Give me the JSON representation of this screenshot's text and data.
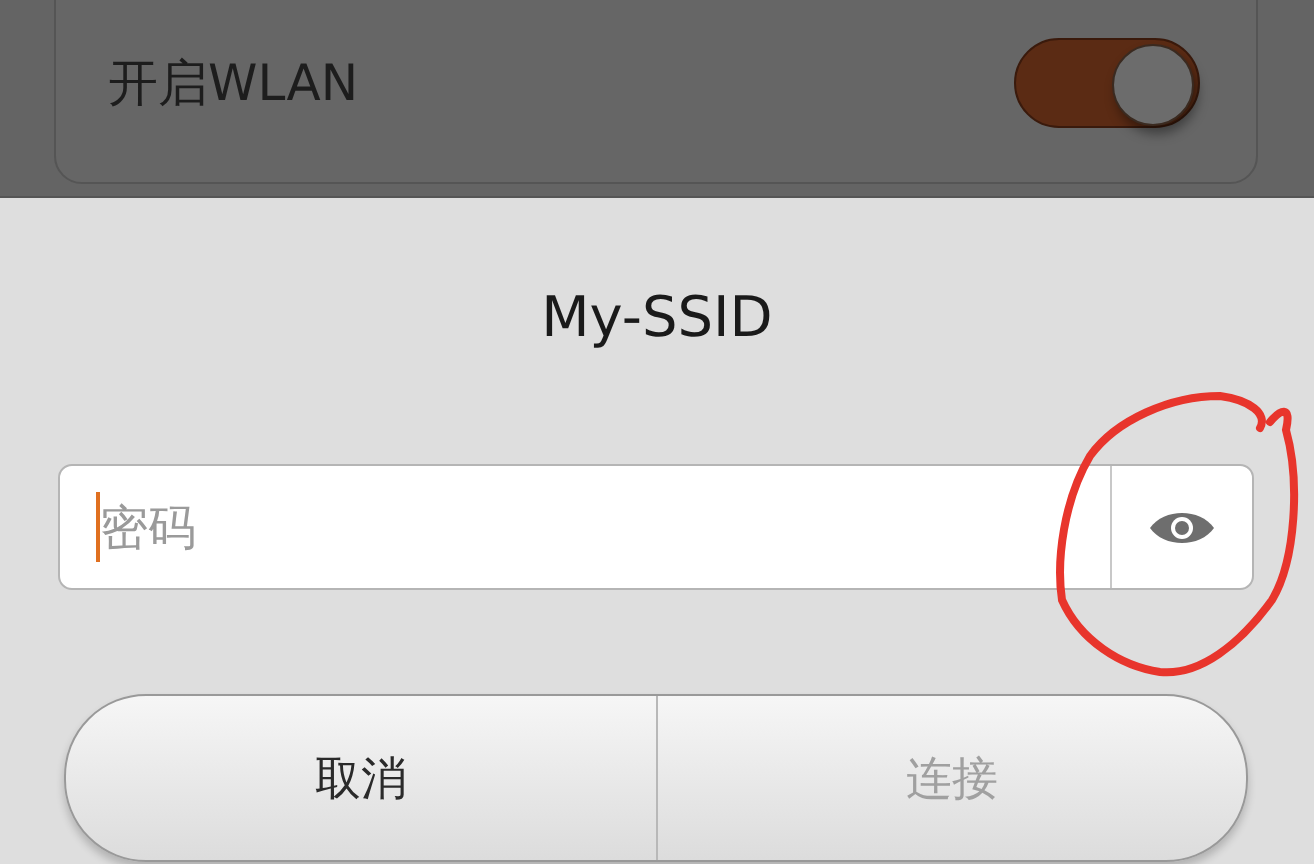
{
  "wlan_setting": {
    "label": "开启WLAN",
    "on": true
  },
  "dialog": {
    "title": "My-SSID",
    "password_field": {
      "placeholder": "密码"
    },
    "buttons": [
      {
        "label": "取消",
        "disabled": false
      },
      {
        "label": "连接",
        "disabled": true
      }
    ]
  }
}
